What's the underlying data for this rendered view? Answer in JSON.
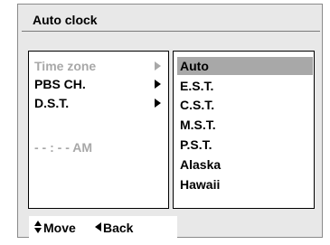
{
  "title": "Auto clock",
  "left_menu": {
    "items": [
      {
        "label": "Time zone"
      },
      {
        "label": "PBS CH."
      },
      {
        "label": "D.S.T."
      }
    ],
    "time_display": "- - : - - AM"
  },
  "options": [
    "Auto",
    "E.S.T.",
    "C.S.T.",
    "M.S.T.",
    "P.S.T.",
    "Alaska",
    "Hawaii"
  ],
  "footer": {
    "move_label": "Move",
    "back_label": "Back"
  }
}
